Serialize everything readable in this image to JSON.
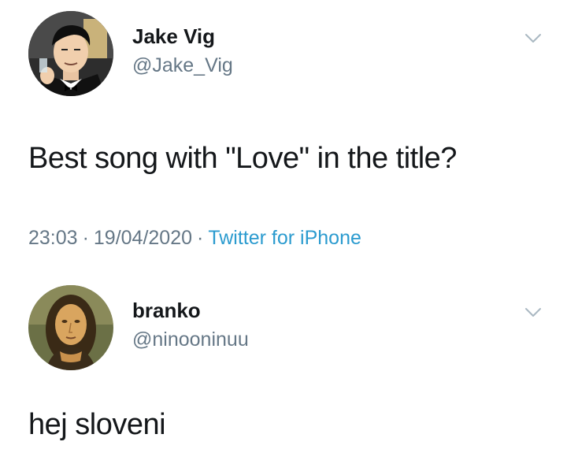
{
  "main_tweet": {
    "display_name": "Jake Vig",
    "handle": "@Jake_Vig",
    "text": "Best song with \"Love\" in the title?",
    "time": "23:03",
    "separator": "·",
    "date": "19/04/2020",
    "source": "Twitter for iPhone",
    "avatar_icon": "cartoon-man-avatar-icon"
  },
  "reply_tweet": {
    "display_name": "branko",
    "handle": "@ninooninuu",
    "text": "hej sloveni",
    "avatar_icon": "mona-lisa-avatar-icon"
  },
  "colors": {
    "text_primary": "#14171a",
    "text_secondary": "#657786",
    "link": "#2b9bcf",
    "background": "#ffffff"
  }
}
